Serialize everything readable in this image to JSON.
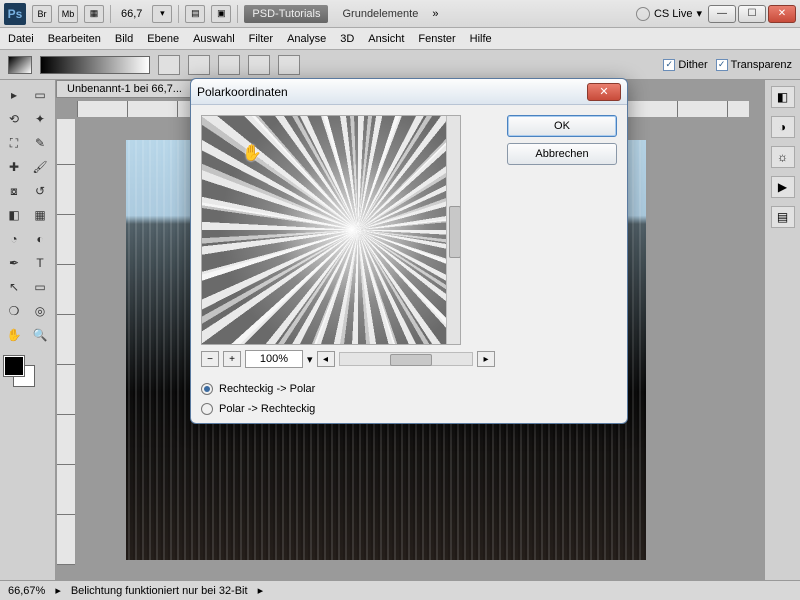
{
  "titlebar": {
    "zoom": "66,7",
    "tabs": [
      "PSD-Tutorials",
      "Grundelemente"
    ],
    "cslive": "CS Live"
  },
  "menu": [
    "Datei",
    "Bearbeiten",
    "Bild",
    "Ebene",
    "Auswahl",
    "Filter",
    "Analyse",
    "3D",
    "Ansicht",
    "Fenster",
    "Hilfe"
  ],
  "optbar": {
    "dither": "Dither",
    "transparenz": "Transparenz"
  },
  "doc": {
    "tab": "Unbenannt-1 bei 66,7..."
  },
  "status": {
    "zoom": "66,67%",
    "msg": "Belichtung funktioniert nur bei 32-Bit"
  },
  "dialog": {
    "title": "Polarkoordinaten",
    "ok": "OK",
    "cancel": "Abbrechen",
    "zoom": "100%",
    "opt1": "Rechteckig -> Polar",
    "opt2": "Polar -> Rechteckig"
  }
}
